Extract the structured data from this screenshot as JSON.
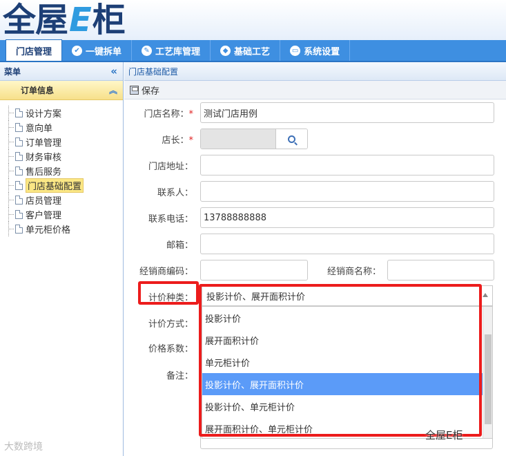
{
  "logo": {
    "part1": "全屋",
    "part2": "E",
    "part3": "柜"
  },
  "topmenu": {
    "items": [
      {
        "label": "门店管理",
        "icon": "none",
        "active": true
      },
      {
        "label": "一键拆单",
        "icon": "check-circle-icon"
      },
      {
        "label": "工艺库管理",
        "icon": "edit-circle-icon"
      },
      {
        "label": "基础工艺",
        "icon": "tag-circle-icon"
      },
      {
        "label": "系统设置",
        "icon": "monitor-circle-icon"
      }
    ]
  },
  "sidebar": {
    "title": "菜单",
    "group": "订单信息",
    "items": [
      {
        "label": "设计方案"
      },
      {
        "label": "意向单"
      },
      {
        "label": "订单管理"
      },
      {
        "label": "财务审核"
      },
      {
        "label": "售后服务"
      },
      {
        "label": "门店基础配置",
        "selected": true
      },
      {
        "label": "店员管理"
      },
      {
        "label": "客户管理"
      },
      {
        "label": "单元柜价格"
      }
    ]
  },
  "breadcrumb": "门店基础配置",
  "toolbar": {
    "save_label": "保存"
  },
  "form": {
    "store_name": {
      "label": "门店名称：",
      "required": "*",
      "value": "测试门店用例"
    },
    "manager": {
      "label": "店长：",
      "required": "*",
      "value": ""
    },
    "address": {
      "label": "门店地址：",
      "value": ""
    },
    "contact": {
      "label": "联系人：",
      "value": ""
    },
    "phone": {
      "label": "联系电话：",
      "value": "13788888888"
    },
    "email": {
      "label": "邮箱：",
      "value": ""
    },
    "dealer_code": {
      "label": "经销商编码：",
      "value": ""
    },
    "dealer_name": {
      "label": "经销商名称：",
      "value": ""
    },
    "pricing_type": {
      "label": "计价种类：",
      "value": "投影计价、展开面积计价",
      "options": [
        "投影计价",
        "展开面积计价",
        "单元柜计价",
        "投影计价、展开面积计价",
        "投影计价、单元柜计价",
        "展开面积计价、单元柜计价"
      ],
      "selected_index": 3
    },
    "pricing_method": {
      "label": "计价方式："
    },
    "price_coefficient": {
      "label": "价格系数："
    },
    "remark": {
      "label": "备注：",
      "value": ""
    }
  },
  "watermarks": {
    "left": "大数跨境",
    "right": "全屋E柜"
  },
  "colors": {
    "menu_bar": "#3e8fe1",
    "highlight": "#ec1c1c",
    "selected_option": "#5b9bf8"
  }
}
